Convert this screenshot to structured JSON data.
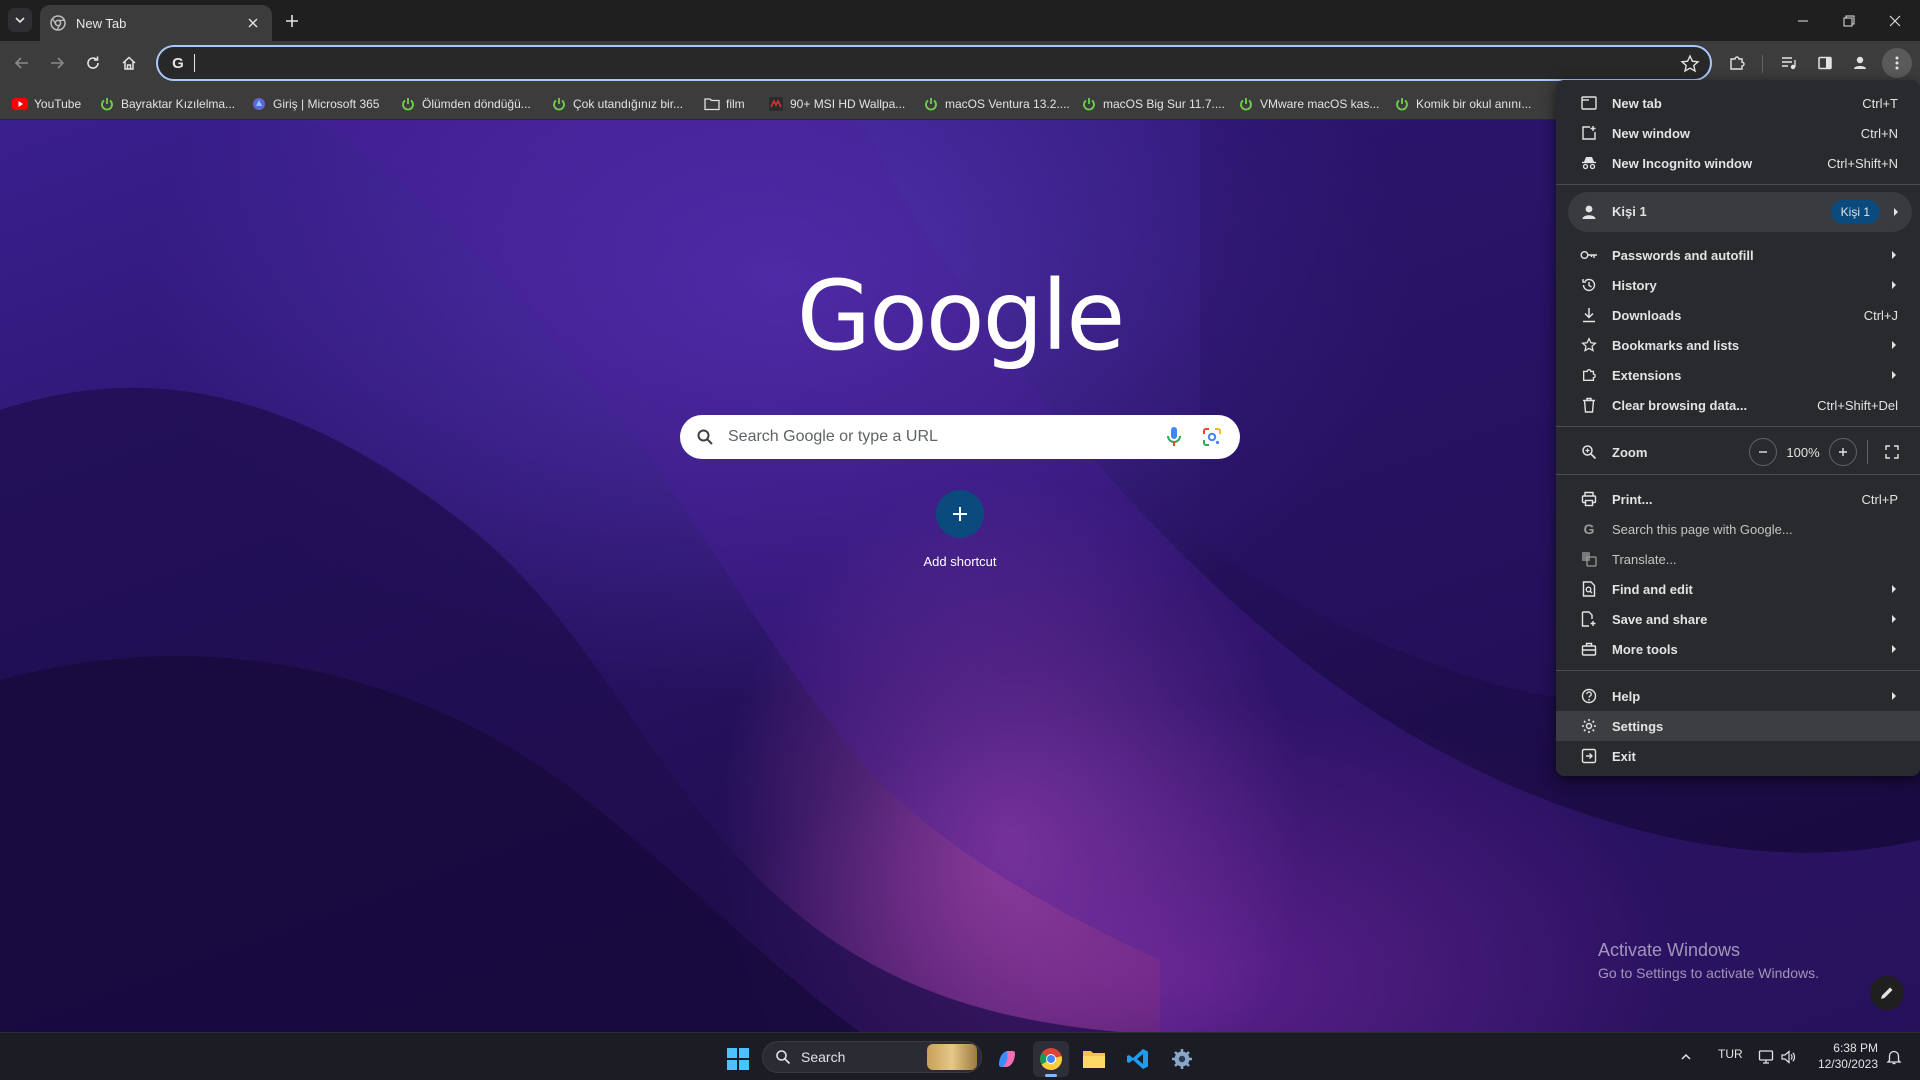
{
  "tabs": [
    {
      "title": "New Tab"
    }
  ],
  "omnibox": {
    "value": ""
  },
  "bookmarks": [
    {
      "label": "YouTube",
      "icon": "youtube-icon"
    },
    {
      "label": "Bayraktar Kızılelma...",
      "icon": "power-icon"
    },
    {
      "label": "Giriş | Microsoft 365",
      "icon": "microsoft-icon"
    },
    {
      "label": "Ölümden döndüğü...",
      "icon": "power-icon"
    },
    {
      "label": "Çok utandığınız bir...",
      "icon": "power-icon"
    },
    {
      "label": "film",
      "icon": "folder-icon"
    },
    {
      "label": "90+ MSI HD Wallpa...",
      "icon": "msi-icon"
    },
    {
      "label": "macOS Ventura 13.2....",
      "icon": "power-icon"
    },
    {
      "label": "macOS Big Sur 11.7....",
      "icon": "power-icon"
    },
    {
      "label": "VMware macOS kas...",
      "icon": "power-icon"
    },
    {
      "label": "Komik bir okul anını...",
      "icon": "power-icon"
    }
  ],
  "ntp": {
    "logo": "Google",
    "search_placeholder": "Search Google or type a URL",
    "shortcut_label": "Add shortcut"
  },
  "watermark": {
    "title": "Activate Windows",
    "subtitle": "Go to Settings to activate Windows."
  },
  "menu": {
    "new_tab": {
      "label": "New tab",
      "shortcut": "Ctrl+T"
    },
    "new_window": {
      "label": "New window",
      "shortcut": "Ctrl+N"
    },
    "new_incognito": {
      "label": "New Incognito window",
      "shortcut": "Ctrl+Shift+N"
    },
    "profile": {
      "label": "Kişi 1",
      "badge": "Kişi 1"
    },
    "passwords": {
      "label": "Passwords and autofill"
    },
    "history": {
      "label": "History"
    },
    "downloads": {
      "label": "Downloads",
      "shortcut": "Ctrl+J"
    },
    "bookmarks": {
      "label": "Bookmarks and lists"
    },
    "extensions": {
      "label": "Extensions"
    },
    "clear_data": {
      "label": "Clear browsing data...",
      "shortcut": "Ctrl+Shift+Del"
    },
    "zoom": {
      "label": "Zoom",
      "value": "100%"
    },
    "print": {
      "label": "Print...",
      "shortcut": "Ctrl+P"
    },
    "search_page": {
      "label": "Search this page with Google..."
    },
    "translate": {
      "label": "Translate..."
    },
    "find_edit": {
      "label": "Find and edit"
    },
    "save_share": {
      "label": "Save and share"
    },
    "more_tools": {
      "label": "More tools"
    },
    "help": {
      "label": "Help"
    },
    "settings": {
      "label": "Settings"
    },
    "exit": {
      "label": "Exit"
    }
  },
  "taskbar": {
    "search_label": "Search",
    "language": "TUR",
    "time": "6:38 PM",
    "date": "12/30/2023"
  },
  "colors": {
    "accent": "#a8c7fa",
    "menu_bg": "#292a2d",
    "shortcut_circle": "#0b4a7d"
  }
}
